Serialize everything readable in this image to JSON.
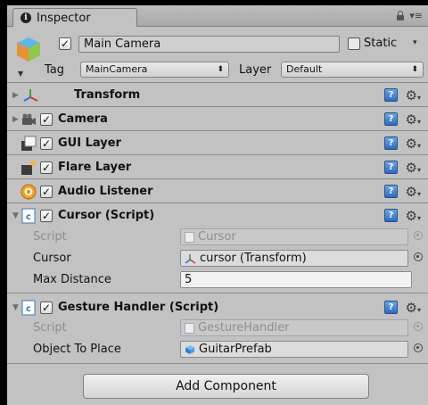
{
  "tab": {
    "label": "Inspector"
  },
  "gameObject": {
    "active": true,
    "name": "Main Camera",
    "static_label": "Static",
    "static": false,
    "tag_label": "Tag",
    "tag_value": "MainCamera",
    "layer_label": "Layer",
    "layer_value": "Default"
  },
  "components": [
    {
      "title": "Transform",
      "icon": "transform-icon"
    },
    {
      "title": "Camera",
      "icon": "camera-icon",
      "enabled": true
    },
    {
      "title": "GUI Layer",
      "icon": "gui-layer-icon",
      "enabled": true
    },
    {
      "title": "Flare Layer",
      "icon": "flare-layer-icon",
      "enabled": true
    },
    {
      "title": "Audio Listener",
      "icon": "audio-listener-icon",
      "enabled": true
    },
    {
      "title": "Cursor (Script)",
      "icon": "script-icon",
      "enabled": true,
      "props": [
        {
          "label": "Script",
          "value": "Cursor"
        },
        {
          "label": "Cursor",
          "value": "cursor (Transform)"
        },
        {
          "label": "Max Distance",
          "value": "5"
        }
      ]
    },
    {
      "title": "Gesture Handler (Script)",
      "icon": "script-icon",
      "enabled": true,
      "props": [
        {
          "label": "Script",
          "value": "GestureHandler"
        },
        {
          "label": "Object To Place",
          "value": "GuitarPrefab"
        }
      ]
    }
  ],
  "add_component_label": "Add Component",
  "colors": {
    "panel": "#c2c2c2",
    "help_icon": "#2d6cbf",
    "prefab": "#3e8de0"
  }
}
